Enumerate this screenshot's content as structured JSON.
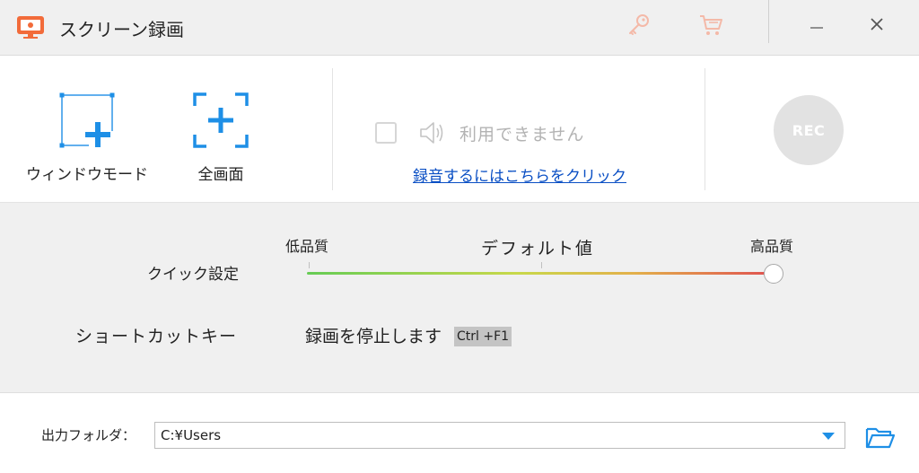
{
  "window": {
    "title": "スクリーン録画",
    "icons": [
      "app-icon",
      "key-icon",
      "cart-icon",
      "minimize-icon",
      "close-icon"
    ]
  },
  "modes": {
    "window_label": "ウィンドウモード",
    "fullscreen_label": "全画面"
  },
  "audio": {
    "checkbox_checked": false,
    "status": "利用できません",
    "link": "録音するにはこちらをクリック"
  },
  "record": {
    "label": "REC"
  },
  "quick_settings": {
    "label": "クイック設定",
    "low": "低品質",
    "default": "デフォルト値",
    "high": "高品質",
    "level": 1.0
  },
  "shortcut": {
    "label": "ショートカットキー",
    "text": "録画を停止します",
    "key": "Ctrl +F1"
  },
  "output": {
    "label": "出力フォルダ：",
    "path": "C:¥Users"
  },
  "colors": {
    "accent": "#1e8fe6",
    "icon_orange": "#f26b3a",
    "disabled_red": "#f4b9a8",
    "link": "#0a4fc4",
    "rec_disabled": "#e2e2e2"
  }
}
